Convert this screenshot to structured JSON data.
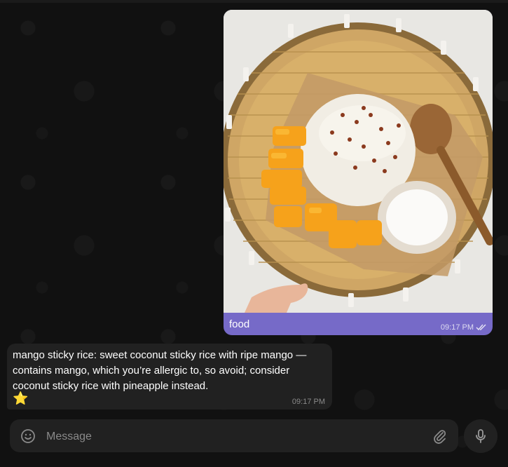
{
  "outgoing": {
    "caption": "food",
    "time": "09:17 PM",
    "status_icon": "double-check-icon",
    "photo_subject": "mango sticky rice",
    "bubble_color": "#766ac8"
  },
  "incoming": {
    "text": "mango sticky rice: sweet coconut sticky rice with ripe mango — contains mango, which you’re allergic to, so avoid; consider coconut sticky rice with pineapple instead.",
    "emoji": "⭐",
    "time": "09:17 PM",
    "bubble_color": "#212121"
  },
  "composer": {
    "placeholder": "Message",
    "emoji_icon": "smile-icon",
    "attach_icon": "paperclip-icon",
    "mic_icon": "microphone-icon"
  }
}
